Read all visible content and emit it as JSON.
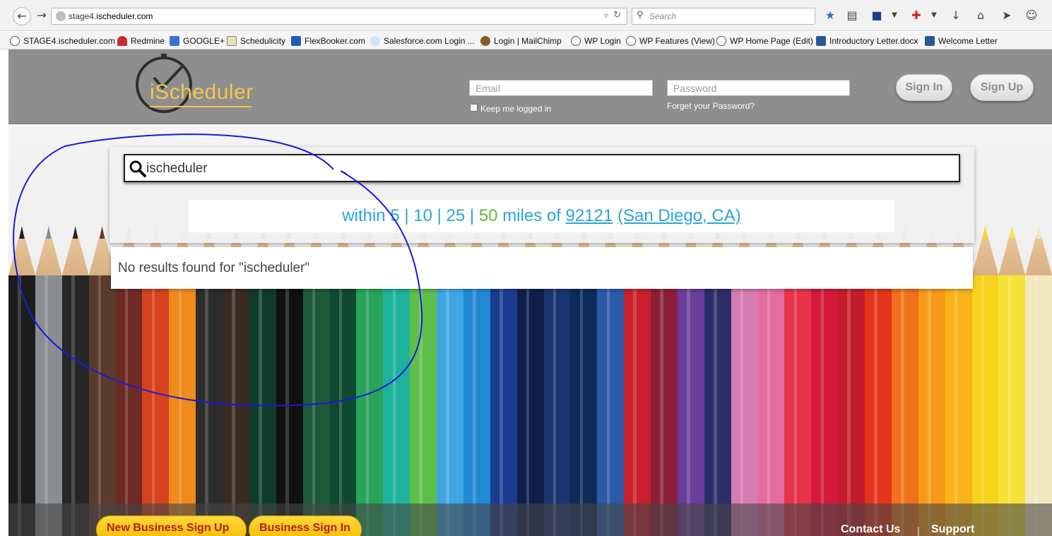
{
  "browser": {
    "url_prefix": "stage4.",
    "url_domain": "ischeduler.com",
    "search_placeholder": "Search"
  },
  "bookmarks": [
    {
      "label": "STAGE4.ischeduler.com",
      "icon": "clock-icon"
    },
    {
      "label": "Redmine",
      "icon": "redmine-icon"
    },
    {
      "label": "GOOGLE+",
      "icon": "google-icon"
    },
    {
      "label": "Schedulicity",
      "icon": "document-icon"
    },
    {
      "label": "FlexBooker.com",
      "icon": "flexbooker-icon"
    },
    {
      "label": "Salesforce.com Login ...",
      "icon": "cloud-icon"
    },
    {
      "label": "Login | MailChimp",
      "icon": "mailchimp-icon"
    },
    {
      "label": "WP Login",
      "icon": "clock-icon"
    },
    {
      "label": "WP Features (View)",
      "icon": "clock-icon"
    },
    {
      "label": "WP Home Page (Edit)",
      "icon": "clock-icon"
    },
    {
      "label": "Introductory Letter.docx",
      "icon": "word-icon"
    },
    {
      "label": "Welcome Letter",
      "icon": "word-icon"
    }
  ],
  "header": {
    "logo_text": "iScheduler",
    "email_placeholder": "Email",
    "password_placeholder": "Password",
    "keep_logged_in": "Keep me logged in",
    "forgot_password": "Forget your Password?",
    "sign_in": "Sign In",
    "sign_up": "Sign Up"
  },
  "search": {
    "query": "ischeduler",
    "radius_within": "within",
    "radius_options": [
      "5",
      "10",
      "25",
      "50"
    ],
    "selected_radius": "50",
    "miles_of": "miles of",
    "zip": "92121",
    "location": "(San Diego, CA)",
    "no_results": "No results found for \"ischeduler\""
  },
  "footer": {
    "new_business_signup": "New Business Sign Up",
    "business_signin": "Business Sign In",
    "contact_us": "Contact Us",
    "separator": "|",
    "support": "Support"
  },
  "colors": {
    "header_bg": "#8e8e8e",
    "logo_accent": "#f5c84a",
    "link_blue": "#2aa5d6",
    "selected_green": "#6db33f",
    "footer_button": "#f2b900",
    "footer_button_text": "#b32012",
    "annotation_stroke": "#1a1ad6"
  }
}
